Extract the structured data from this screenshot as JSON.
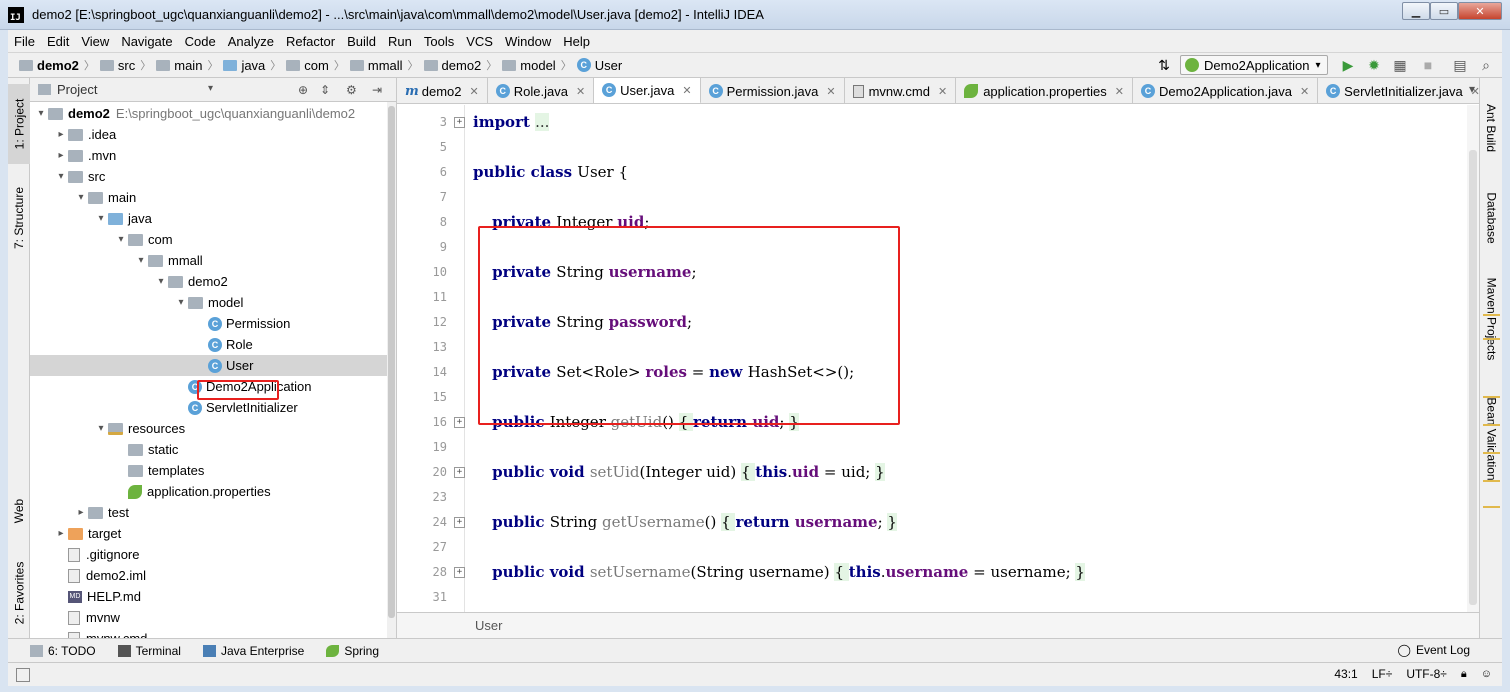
{
  "window": {
    "title": "demo2 [E:\\springboot_ugc\\quanxianguanli\\demo2] - ...\\src\\main\\java\\com\\mmall\\demo2\\model\\User.java [demo2] - IntelliJ IDEA",
    "app_icon_text": "IJ",
    "minimize": "▁",
    "maximize": "▭",
    "close": "✕"
  },
  "menu": [
    "File",
    "Edit",
    "View",
    "Navigate",
    "Code",
    "Analyze",
    "Refactor",
    "Build",
    "Run",
    "Tools",
    "VCS",
    "Window",
    "Help"
  ],
  "breadcrumb": [
    {
      "label": "demo2",
      "bold": true
    },
    {
      "label": "src"
    },
    {
      "label": "main"
    },
    {
      "label": "java"
    },
    {
      "label": "com"
    },
    {
      "label": "mmall"
    },
    {
      "label": "demo2"
    },
    {
      "label": "model"
    },
    {
      "label": "User"
    }
  ],
  "run_config": "Demo2Application",
  "left_strip": {
    "project": "1: Project",
    "structure": "7: Structure",
    "web": "Web",
    "favorites": "2: Favorites"
  },
  "project_panel": {
    "title": "Project",
    "tree": [
      {
        "label": "demo2",
        "path": "E:\\springboot_ugc\\quanxianguanli\\demo2",
        "indent": 0,
        "arrow": "▾",
        "icon": "folder",
        "bold": true
      },
      {
        "label": ".idea",
        "indent": 1,
        "arrow": "▸",
        "icon": "folder"
      },
      {
        "label": ".mvn",
        "indent": 1,
        "arrow": "▸",
        "icon": "folder"
      },
      {
        "label": "src",
        "indent": 1,
        "arrow": "▾",
        "icon": "folder"
      },
      {
        "label": "main",
        "indent": 2,
        "arrow": "▾",
        "icon": "folder"
      },
      {
        "label": "java",
        "indent": 3,
        "arrow": "▾",
        "icon": "folder-blue"
      },
      {
        "label": "com",
        "indent": 4,
        "arrow": "▾",
        "icon": "folder"
      },
      {
        "label": "mmall",
        "indent": 5,
        "arrow": "▾",
        "icon": "folder"
      },
      {
        "label": "demo2",
        "indent": 6,
        "arrow": "▾",
        "icon": "folder"
      },
      {
        "label": "model",
        "indent": 7,
        "arrow": "▾",
        "icon": "folder"
      },
      {
        "label": "Permission",
        "indent": 8,
        "arrow": "",
        "icon": "class"
      },
      {
        "label": "Role",
        "indent": 8,
        "arrow": "",
        "icon": "class"
      },
      {
        "label": "User",
        "indent": 8,
        "arrow": "",
        "icon": "class",
        "selected": true
      },
      {
        "label": "Demo2Application",
        "indent": 7,
        "arrow": "",
        "icon": "class"
      },
      {
        "label": "ServletInitializer",
        "indent": 7,
        "arrow": "",
        "icon": "class"
      },
      {
        "label": "resources",
        "indent": 3,
        "arrow": "▾",
        "icon": "folder-res"
      },
      {
        "label": "static",
        "indent": 4,
        "arrow": "",
        "icon": "folder"
      },
      {
        "label": "templates",
        "indent": 4,
        "arrow": "",
        "icon": "folder"
      },
      {
        "label": "application.properties",
        "indent": 4,
        "arrow": "",
        "icon": "leaf"
      },
      {
        "label": "test",
        "indent": 2,
        "arrow": "▸",
        "icon": "folder"
      },
      {
        "label": "target",
        "indent": 1,
        "arrow": "▸",
        "icon": "folder-orange"
      },
      {
        "label": ".gitignore",
        "indent": 1,
        "arrow": "",
        "icon": "file"
      },
      {
        "label": "demo2.iml",
        "indent": 1,
        "arrow": "",
        "icon": "file"
      },
      {
        "label": "HELP.md",
        "indent": 1,
        "arrow": "",
        "icon": "md"
      },
      {
        "label": "mvnw",
        "indent": 1,
        "arrow": "",
        "icon": "file"
      },
      {
        "label": "mvnw.cmd",
        "indent": 1,
        "arrow": "",
        "icon": "file"
      }
    ]
  },
  "tabs": [
    {
      "label": "demo2",
      "icon": "m"
    },
    {
      "label": "Role.java",
      "icon": "class"
    },
    {
      "label": "User.java",
      "icon": "class",
      "active": true
    },
    {
      "label": "Permission.java",
      "icon": "class"
    },
    {
      "label": "mvnw.cmd",
      "icon": "cmd"
    },
    {
      "label": "application.properties",
      "icon": "props"
    },
    {
      "label": "Demo2Application.java",
      "icon": "class"
    },
    {
      "label": "ServletInitializer.java",
      "icon": "class"
    }
  ],
  "code": [
    {
      "n": "3",
      "fold": "+",
      "tokens": [
        [
          "kw",
          "import "
        ],
        [
          "fold-dots",
          "..."
        ]
      ]
    },
    {
      "n": "5",
      "tokens": []
    },
    {
      "n": "6",
      "tokens": [
        [
          "kw",
          "public class "
        ],
        [
          "",
          "User {"
        ]
      ]
    },
    {
      "n": "7",
      "tokens": []
    },
    {
      "n": "8",
      "tokens": [
        [
          "",
          "    "
        ],
        [
          "kw",
          "private "
        ],
        [
          "",
          "Integer "
        ],
        [
          "fld",
          "uid"
        ],
        [
          "",
          ";"
        ]
      ]
    },
    {
      "n": "9",
      "tokens": []
    },
    {
      "n": "10",
      "tokens": [
        [
          "",
          "    "
        ],
        [
          "kw",
          "private "
        ],
        [
          "",
          "String "
        ],
        [
          "fld",
          "username"
        ],
        [
          "",
          ";"
        ]
      ]
    },
    {
      "n": "11",
      "tokens": []
    },
    {
      "n": "12",
      "tokens": [
        [
          "",
          "    "
        ],
        [
          "kw",
          "private "
        ],
        [
          "",
          "String "
        ],
        [
          "fld",
          "password"
        ],
        [
          "",
          ";"
        ]
      ]
    },
    {
      "n": "13",
      "tokens": []
    },
    {
      "n": "14",
      "tokens": [
        [
          "",
          "    "
        ],
        [
          "kw",
          "private "
        ],
        [
          "",
          "Set<Role> "
        ],
        [
          "fld",
          "roles"
        ],
        [
          "",
          " = "
        ],
        [
          "kw",
          "new "
        ],
        [
          "",
          "HashSet<>();"
        ]
      ]
    },
    {
      "n": "15",
      "tokens": []
    },
    {
      "n": "16",
      "fold": "+",
      "tokens": [
        [
          "",
          "    "
        ],
        [
          "kw",
          "public "
        ],
        [
          "",
          "Integer "
        ],
        [
          "mth",
          "getUid"
        ],
        [
          "",
          "() "
        ],
        [
          "brc",
          "{ "
        ],
        [
          "kw",
          "return "
        ],
        [
          "fld",
          "uid"
        ],
        [
          "",
          "; "
        ],
        [
          "brc",
          "}"
        ]
      ]
    },
    {
      "n": "19",
      "tokens": []
    },
    {
      "n": "20",
      "fold": "+",
      "tokens": [
        [
          "",
          "    "
        ],
        [
          "kw",
          "public void "
        ],
        [
          "mth",
          "setUid"
        ],
        [
          "",
          "(Integer uid) "
        ],
        [
          "brc",
          "{ "
        ],
        [
          "kw",
          "this"
        ],
        [
          "",
          "."
        ],
        [
          "fld",
          "uid"
        ],
        [
          "",
          " = uid; "
        ],
        [
          "brc",
          "}"
        ]
      ]
    },
    {
      "n": "23",
      "tokens": []
    },
    {
      "n": "24",
      "fold": "+",
      "tokens": [
        [
          "",
          "    "
        ],
        [
          "kw",
          "public "
        ],
        [
          "",
          "String "
        ],
        [
          "mth",
          "getUsername"
        ],
        [
          "",
          "() "
        ],
        [
          "brc",
          "{ "
        ],
        [
          "kw",
          "return "
        ],
        [
          "fld",
          "username"
        ],
        [
          "",
          "; "
        ],
        [
          "brc",
          "}"
        ]
      ]
    },
    {
      "n": "27",
      "tokens": []
    },
    {
      "n": "28",
      "fold": "+",
      "tokens": [
        [
          "",
          "    "
        ],
        [
          "kw",
          "public void "
        ],
        [
          "mth",
          "setUsername"
        ],
        [
          "",
          "(String username) "
        ],
        [
          "brc",
          "{ "
        ],
        [
          "kw",
          "this"
        ],
        [
          "",
          "."
        ],
        [
          "fld",
          "username"
        ],
        [
          "",
          " = username; "
        ],
        [
          "brc",
          "}"
        ]
      ]
    },
    {
      "n": "31",
      "tokens": []
    }
  ],
  "editor_status": "User",
  "right_strip": [
    "Ant Build",
    "Database",
    "Maven Projects",
    "Bean Validation"
  ],
  "bottom_tools": [
    {
      "label": "6: TODO"
    },
    {
      "label": "Terminal"
    },
    {
      "label": "Java Enterprise"
    },
    {
      "label": "Spring"
    }
  ],
  "event_log": "Event Log",
  "status": {
    "position": "43:1",
    "line_sep": "LF÷",
    "encoding": "UTF-8÷"
  },
  "colors": {
    "keyword": "#000080",
    "field": "#660e7a",
    "highlight_box": "#e8201e"
  }
}
